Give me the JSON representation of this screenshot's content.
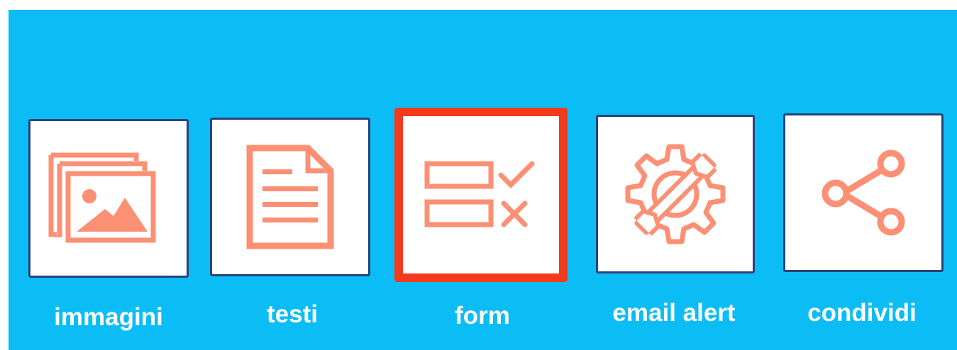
{
  "colors": {
    "background": "#0bbdf4",
    "tile_border": "#27437e",
    "icon": "#fc9074",
    "selected_border": "#f23a1c",
    "label": "#ffffff"
  },
  "tiles": [
    {
      "label": "immagini",
      "icon": "images-icon",
      "selected": false
    },
    {
      "label": "testi",
      "icon": "document-icon",
      "selected": false
    },
    {
      "label": "form",
      "icon": "form-icon",
      "selected": true
    },
    {
      "label": "email alert",
      "icon": "gear-wrench-icon",
      "selected": false
    },
    {
      "label": "condividi",
      "icon": "share-icon",
      "selected": false
    }
  ]
}
